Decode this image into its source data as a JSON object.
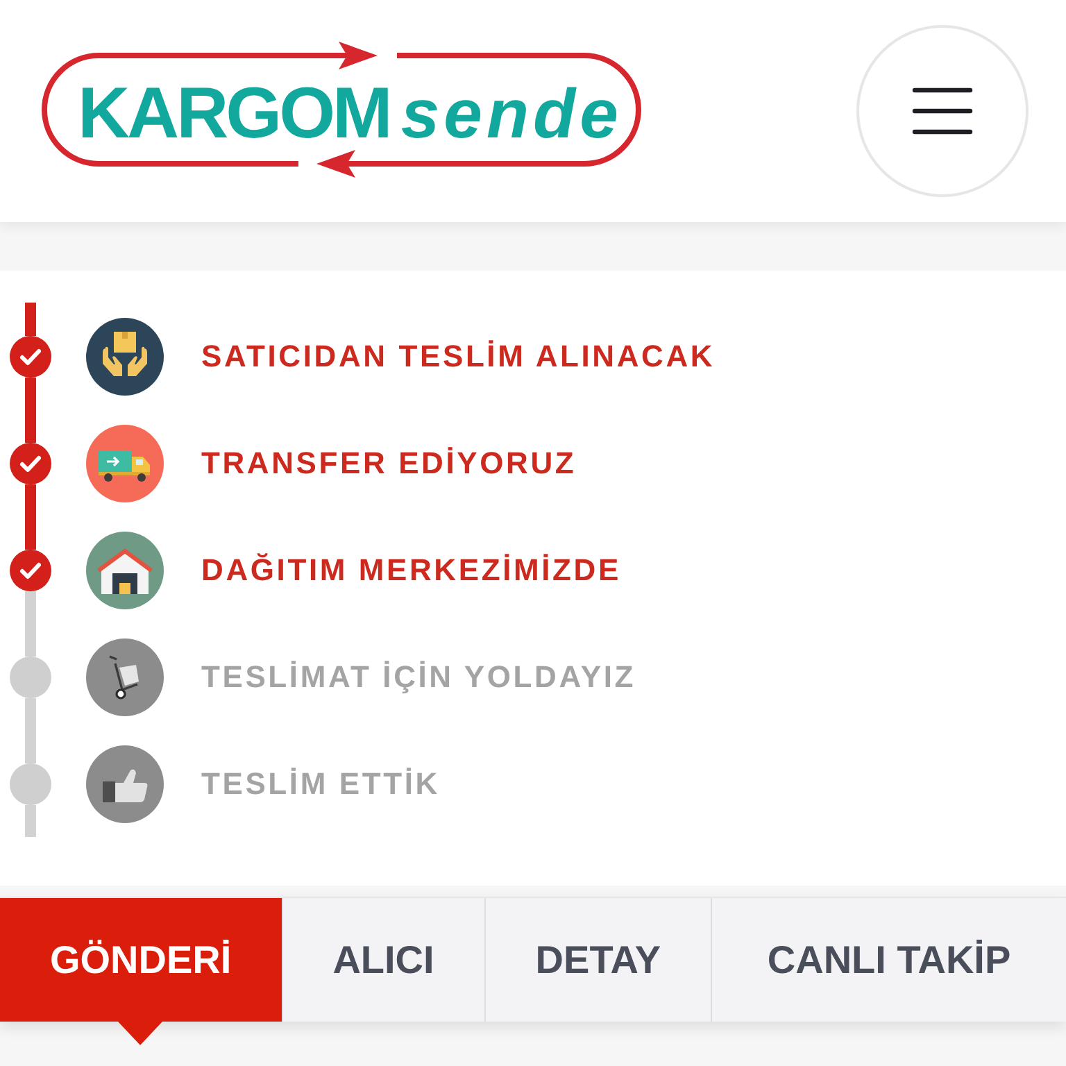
{
  "header": {
    "logo": {
      "main": "KARGOM",
      "accent": "sende"
    }
  },
  "timeline": {
    "steps": [
      {
        "kind": "package",
        "label": "SATICIDAN TESLİM ALINACAK",
        "done": true
      },
      {
        "kind": "truck",
        "label": "TRANSFER EDİYORUZ",
        "done": true
      },
      {
        "kind": "warehouse",
        "label": "DAĞITIM MERKEZİMİZDE",
        "done": true
      },
      {
        "kind": "hand_truck",
        "label": "TESLİMAT İÇİN YOLDAYIZ",
        "done": false
      },
      {
        "kind": "thumbs_up",
        "label": "TESLİM ETTİK",
        "done": false
      }
    ]
  },
  "tabs": [
    {
      "label": "GÖNDERİ",
      "selected": true
    },
    {
      "label": "ALICI",
      "selected": false
    },
    {
      "label": "DETAY",
      "selected": false
    },
    {
      "label": "CANLI TAKİP",
      "selected": false
    }
  ]
}
